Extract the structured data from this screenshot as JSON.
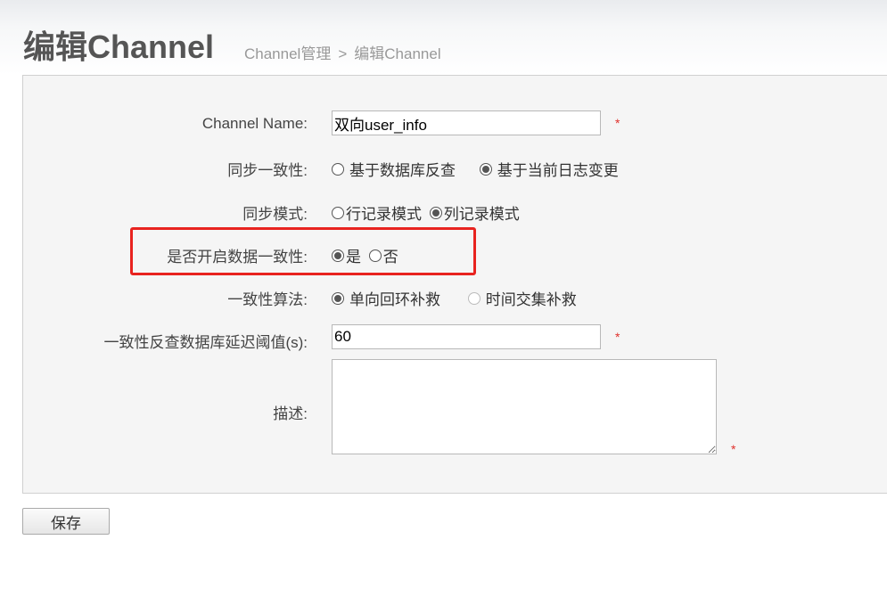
{
  "header": {
    "title": "编辑Channel",
    "breadcrumb": {
      "parent": "Channel管理",
      "separator": ">",
      "current": "编辑Channel"
    }
  },
  "form": {
    "channel_name": {
      "label": "Channel Name:",
      "value": "双向user_info",
      "required_mark": "*"
    },
    "sync_consistency": {
      "label": "同步一致性:",
      "options": [
        {
          "label": "基于数据库反查",
          "checked": false
        },
        {
          "label": "基于当前日志变更",
          "checked": true
        }
      ]
    },
    "sync_mode": {
      "label": "同步模式:",
      "options": [
        {
          "label": "行记录模式",
          "checked": false
        },
        {
          "label": "列记录模式",
          "checked": true
        }
      ]
    },
    "enable_consistency": {
      "label": "是否开启数据一致性:",
      "options": [
        {
          "label": "是",
          "checked": true
        },
        {
          "label": "否",
          "checked": false
        }
      ]
    },
    "consistency_algorithm": {
      "label": "一致性算法:",
      "options": [
        {
          "label": "单向回环补救",
          "checked": true
        },
        {
          "label": "时间交集补救",
          "checked": false,
          "disabled": true
        }
      ]
    },
    "delay_threshold": {
      "label": "一致性反查数据库延迟阈值(s):",
      "value": "60",
      "required_mark": "*"
    },
    "description": {
      "label": "描述:",
      "value": "",
      "required_mark": "*"
    }
  },
  "actions": {
    "save_label": "保存"
  },
  "colors": {
    "highlight": "#e8231f",
    "required": "#e0302b",
    "panel_bg": "#f5f5f5"
  }
}
